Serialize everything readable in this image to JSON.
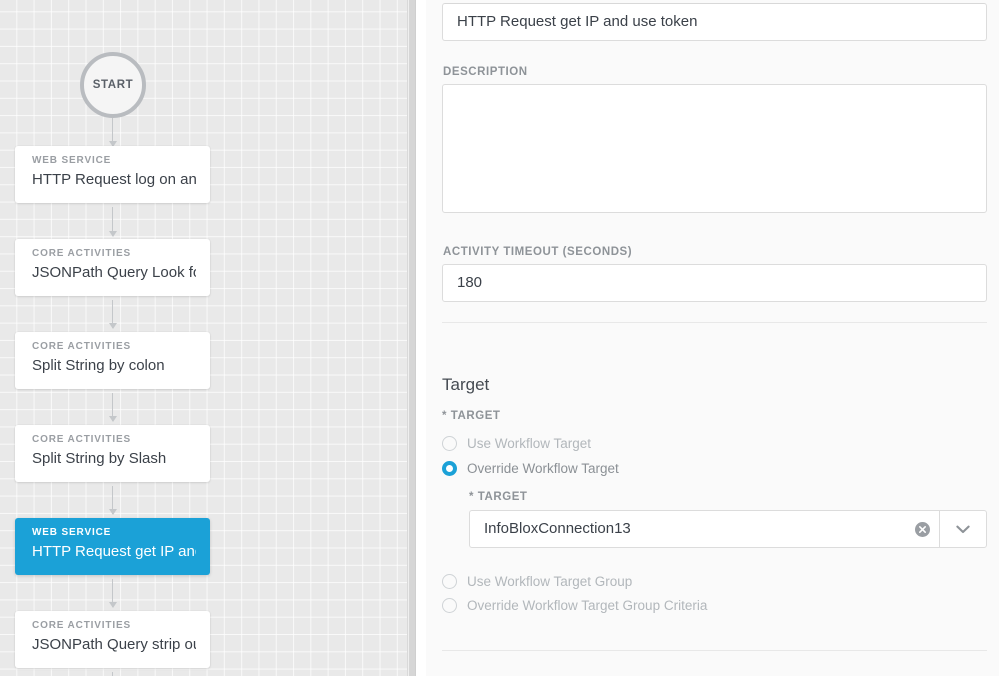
{
  "canvas": {
    "start_node_label": "START",
    "nodes": [
      {
        "category": "WEB SERVICE",
        "name": "HTTP Request log on and ...",
        "selected": false
      },
      {
        "category": "CORE ACTIVITIES",
        "name": "JSONPath Query Look for...",
        "selected": false
      },
      {
        "category": "CORE ACTIVITIES",
        "name": "Split String by colon",
        "selected": false
      },
      {
        "category": "CORE ACTIVITIES",
        "name": "Split String by Slash",
        "selected": false
      },
      {
        "category": "WEB SERVICE",
        "name": "HTTP Request get IP and ...",
        "selected": true
      },
      {
        "category": "CORE ACTIVITIES",
        "name": "JSONPath Query strip ou...",
        "selected": false
      }
    ],
    "grid_background_color": "#e9e9e9",
    "selected_node_color": "#1ba1d7"
  },
  "panel": {
    "name_field": {
      "value": "HTTP Request get IP and use token",
      "placeholder": "Name"
    },
    "description_field": {
      "label": "DESCRIPTION",
      "value": "",
      "placeholder": ""
    },
    "timeout_field": {
      "label": "ACTIVITY TIMEOUT (SECONDS)",
      "value": "180",
      "placeholder": ""
    },
    "target_section": {
      "heading": "Target",
      "required_label": "* TARGET",
      "radios": [
        {
          "label": "Use Workflow Target",
          "selected": false
        },
        {
          "label": "Override Workflow Target",
          "selected": true
        }
      ],
      "target_sub": {
        "required_label": "* TARGET",
        "value": "InfoBloxConnection13",
        "placeholder": "",
        "clear_icon": "clear-circle-icon",
        "toggle_icon": "chevron-down-icon"
      },
      "group_radios": [
        {
          "label": "Use Workflow Target Group",
          "selected": false
        },
        {
          "label": "Override Workflow Target Group Criteria",
          "selected": false
        }
      ]
    },
    "accent_color": "#1ba1d7"
  }
}
